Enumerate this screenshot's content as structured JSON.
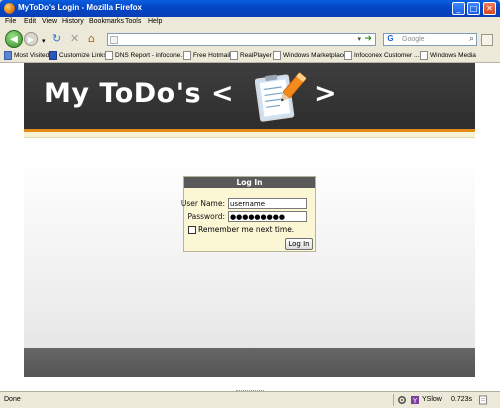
{
  "window": {
    "title": "MyToDo's Login - Mozilla Firefox",
    "minimize": "_",
    "maximize": "□",
    "close": "✕"
  },
  "menu": [
    "File",
    "Edit",
    "View",
    "History",
    "Bookmarks",
    "Tools",
    "Help"
  ],
  "nav": {
    "url": "",
    "search_placeholder": "Google"
  },
  "bookmarks": [
    {
      "label": "Most Visited",
      "icon": "most-visited-icon"
    },
    {
      "label": "Customize Links",
      "icon": "msn-icon"
    },
    {
      "label": "DNS Report - infocone...",
      "icon": "page-icon"
    },
    {
      "label": "Free Hotmail",
      "icon": "page-icon"
    },
    {
      "label": "RealPlayer",
      "icon": "page-icon"
    },
    {
      "label": "Windows Marketplace",
      "icon": "page-icon"
    },
    {
      "label": "Infoconex Customer ...",
      "icon": "page-icon"
    },
    {
      "label": "Windows Media",
      "icon": "page-icon"
    }
  ],
  "page": {
    "header_left": "My ToDo's  <",
    "header_right": ">"
  },
  "login": {
    "title": "Log In",
    "username_label": "User Name:",
    "username_value": "username",
    "password_label": "Password:",
    "password_value": "●●●●●●●●●",
    "remember_label": "Remember me next time.",
    "button": "Log In"
  },
  "status": {
    "text": "Done",
    "yslow": "YSlow",
    "time": "0.723s"
  },
  "colors": {
    "header_bg": "#333333",
    "accent_orange": "#e58a18",
    "login_bg": "#fbf7d5",
    "login_head": "#5a5a5a"
  }
}
